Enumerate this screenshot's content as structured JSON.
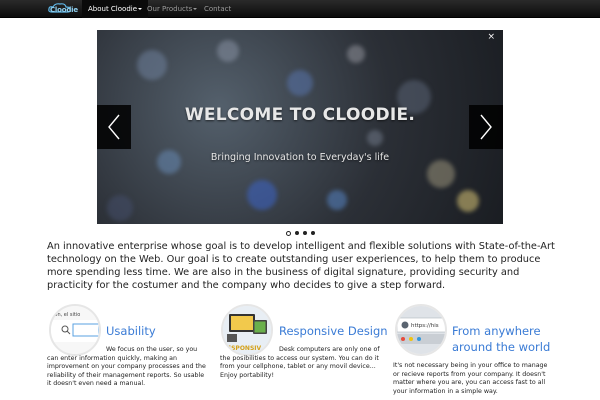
{
  "navbar": {
    "brand": "Cloodie",
    "items": [
      {
        "label": "About Cloodie",
        "active": true
      },
      {
        "label": "Our Products",
        "active": false
      },
      {
        "label": "Contact",
        "active": false
      }
    ]
  },
  "carousel": {
    "close": "×",
    "title": "WELCOME TO CLOODIE.",
    "subtitle": "Bringing Innovation to Everyday's life",
    "slide_count": 4,
    "active_slide": 1
  },
  "intro": "An innovative enterprise whose goal is to develop intelligent and flexible solutions with State-of-the-Art technology on the Web. Our goal is to create outstanding user experiences, to help them to produce more spending less time. We are also in the business of digital signature, providing security and practicity for the costumer and the company who decides to give a step forward.",
  "features": [
    {
      "title": "Usability",
      "text": "We focus on the user, so you can enter information quickly, making an improvement on your company processes and the reliability of their management reports. So usable it doesn't even need a manual.",
      "image_icon": "usability-image",
      "image_text": "ion, el sitio"
    },
    {
      "title": "Responsive Design",
      "text": "Desk computers are only one of the posibilities to access our system. You can do it from your cellphone, tablet or any movil device... Enjoy portability!",
      "image_icon": "responsive-devices-image",
      "image_text": "ESPONSIV"
    },
    {
      "title": "From anywhere around the world",
      "text": "It's not necessary being in your office to manage or recieve reports from your company. It doesn't matter where you are, you can access fast to all your information in a simple way.",
      "image_icon": "browser-address-image",
      "image_text": "https://his"
    }
  ],
  "colors": {
    "accent": "#3a7bd5",
    "navbar": "#111111"
  }
}
